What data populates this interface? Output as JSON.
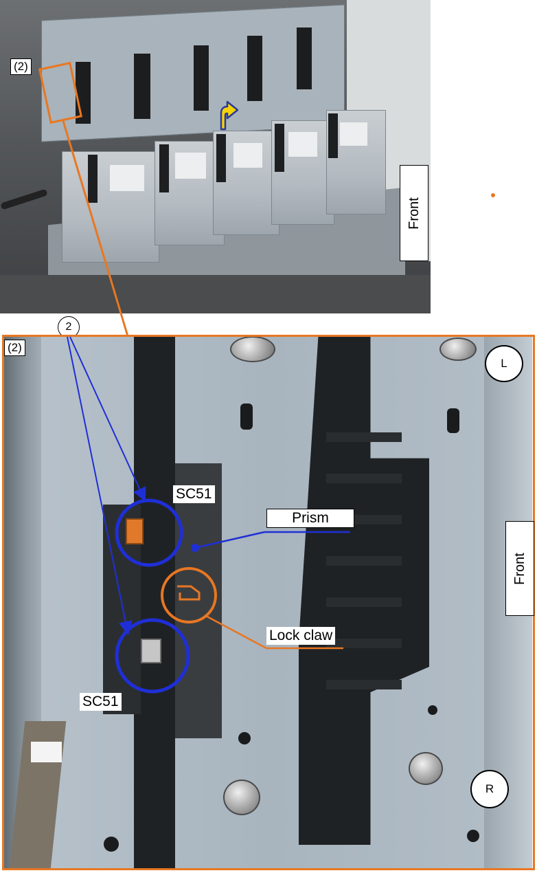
{
  "top_photo": {
    "callout_tag": "(2)",
    "front_label": "Front"
  },
  "bottom_photo": {
    "callout_tag": "(2)",
    "step_number": "2",
    "corner_top": "L",
    "corner_bottom": "R",
    "front_label": "Front",
    "labels": {
      "sensor_top": "SC51",
      "sensor_bottom": "SC51",
      "prism": "Prism",
      "lock_claw": "Lock claw"
    }
  },
  "colors": {
    "callout_orange": "#e87722",
    "pointer_blue": "#1f2fd6",
    "arrow_yellow": "#f5d20a"
  }
}
